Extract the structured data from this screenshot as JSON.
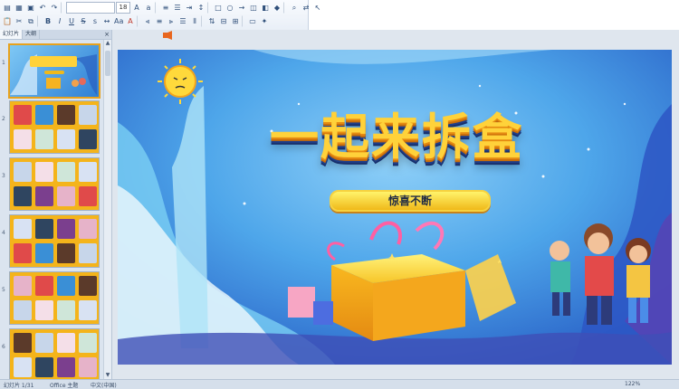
{
  "ribbon": {
    "font_name": "",
    "font_size": "18"
  },
  "left_pane": {
    "tabs": [
      {
        "label": "幻灯片"
      },
      {
        "label": "大纲"
      }
    ],
    "close": "×",
    "slide_numbers": [
      "1",
      "2",
      "3",
      "4",
      "5",
      "6"
    ]
  },
  "slide": {
    "title": "一起来拆盒",
    "subtitle": "惊喜不断",
    "colors": {
      "background": "#3f9be0",
      "title": "#ffd23a",
      "pill": "#f0b91a"
    }
  },
  "status_bar": {
    "slide_info": "幻灯片 1/31",
    "theme": "Office 主题",
    "language": "中文(中国)",
    "zoom": "122%"
  },
  "icons": [
    "save-icon",
    "undo-icon",
    "redo-icon",
    "bold-icon",
    "italic-icon",
    "underline-icon",
    "align-left-icon",
    "align-center-icon",
    "align-right-icon",
    "shapes-icon",
    "arrange-icon",
    "find-icon"
  ]
}
